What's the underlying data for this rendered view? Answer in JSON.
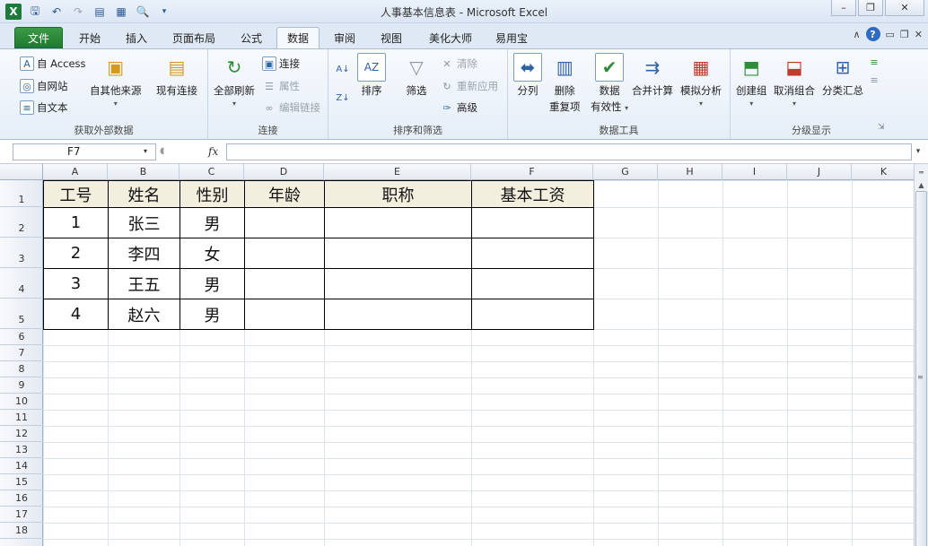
{
  "window": {
    "title": "人事基本信息表 - Microsoft Excel",
    "app_icon": "X"
  },
  "qat": [
    "save-icon",
    "undo-icon",
    "redo-icon",
    "form-icon",
    "calc-icon",
    "print-preview-icon",
    "customize-icon"
  ],
  "tabs": [
    {
      "label": "文件",
      "kind": "file"
    },
    {
      "label": "开始"
    },
    {
      "label": "插入"
    },
    {
      "label": "页面布局"
    },
    {
      "label": "公式"
    },
    {
      "label": "数据",
      "active": true
    },
    {
      "label": "审阅"
    },
    {
      "label": "视图"
    },
    {
      "label": "美化大师"
    },
    {
      "label": "易用宝"
    }
  ],
  "ribbon": {
    "get_external": {
      "label": "获取外部数据",
      "access": "自 Access",
      "web": "自网站",
      "text": "自文本",
      "other": "自其他来源",
      "existing": "现有连接"
    },
    "connections": {
      "label": "连接",
      "refresh_all": "全部刷新",
      "connections": "连接",
      "properties": "属性",
      "edit_links": "编辑链接"
    },
    "sort_filter": {
      "label": "排序和筛选",
      "sort": "排序",
      "filter": "筛选",
      "clear": "清除",
      "reapply": "重新应用",
      "advanced": "高级"
    },
    "data_tools": {
      "label": "数据工具",
      "text_to_columns": "分列",
      "remove_duplicates_1": "删除",
      "remove_duplicates_2": "重复项",
      "validation_1": "数据",
      "validation_2": "有效性",
      "consolidate": "合并计算",
      "what_if": "模拟分析"
    },
    "outline": {
      "label": "分级显示",
      "group": "创建组",
      "ungroup": "取消组合",
      "subtotal": "分类汇总"
    }
  },
  "formula_bar": {
    "name_box": "F7",
    "fx": "fx",
    "formula": ""
  },
  "columns": [
    "A",
    "B",
    "C",
    "D",
    "E",
    "F",
    "G",
    "H",
    "I",
    "J",
    "K"
  ],
  "rows": [
    "1",
    "2",
    "3",
    "4",
    "5",
    "6",
    "7",
    "8",
    "9",
    "10",
    "11",
    "12",
    "13",
    "14",
    "15",
    "16",
    "17",
    "18"
  ],
  "table": {
    "headers": [
      "工号",
      "姓名",
      "性别",
      "年龄",
      "职称",
      "基本工资"
    ],
    "rows": [
      [
        "1",
        "张三",
        "男",
        "",
        "",
        ""
      ],
      [
        "2",
        "李四",
        "女",
        "",
        "",
        ""
      ],
      [
        "3",
        "王五",
        "男",
        "",
        "",
        ""
      ],
      [
        "4",
        "赵六",
        "男",
        "",
        "",
        ""
      ]
    ]
  },
  "colors": {
    "header_fill": "#f2efde",
    "file_tab": "#1f7a2e"
  }
}
